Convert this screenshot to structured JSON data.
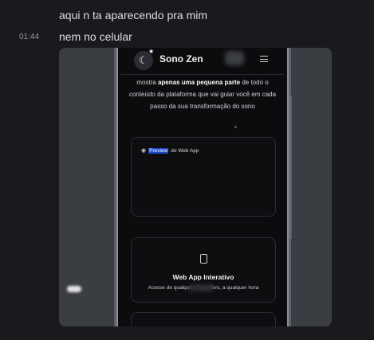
{
  "messages": [
    {
      "text": "aqui n ta aparecendo pra mim"
    },
    {
      "time": "01:44",
      "text": "nem no celular"
    }
  ],
  "attachment": {
    "app_title": "Sono Zen",
    "logo_icon": "moon-icon",
    "menu_icon": "hamburger-icon",
    "intro": {
      "before": "mostra ",
      "bold": "apenas uma pequena parte",
      "after": " de todo o conteúdo da plataforma que vai guiar você em cada passo da sua transformação do sono"
    },
    "preview_card": {
      "highlight": "Preview",
      "rest": " do Web App"
    },
    "feature_card": {
      "icon": "smartphone-icon",
      "title": "Web App Interativo",
      "subtitle": "Acesse de qualquer dispositivo, a qualquer hora"
    }
  },
  "colors": {
    "background": "#1a1a1e",
    "highlight": "#1c47c9"
  }
}
